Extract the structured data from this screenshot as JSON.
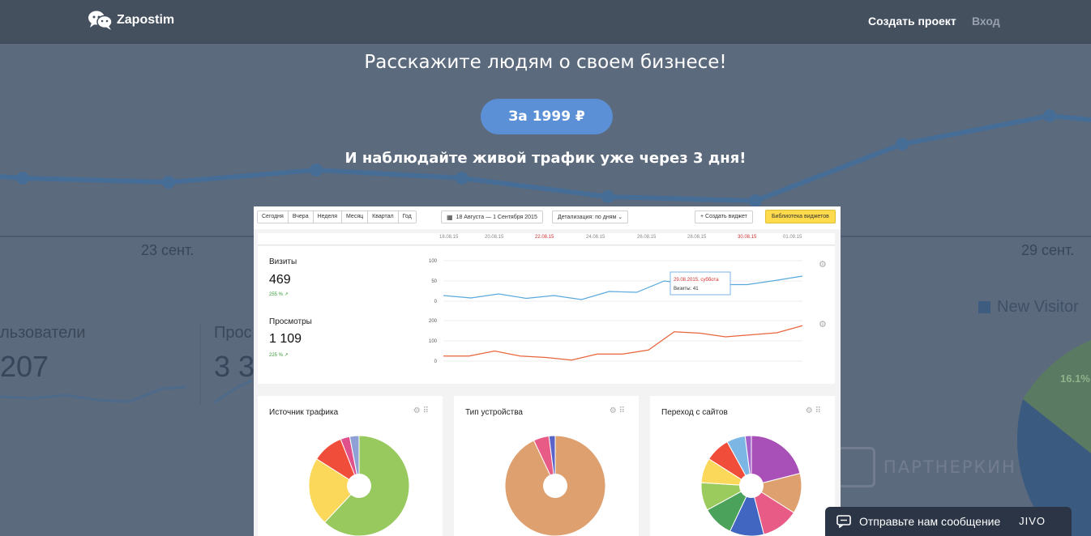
{
  "header": {
    "logo_text": "Zapostim",
    "nav_create": "Создать проект",
    "nav_login": "Вход"
  },
  "hero": {
    "title": "Расскажите людям о своем бизнесе!",
    "cta_label": "За 1999 ₽",
    "subtitle": "И наблюдайте живой трафик уже через 3 дня!"
  },
  "background": {
    "axis_left": "23 сент.",
    "axis_right": "29 сент.",
    "users_label": "льзователи",
    "users_value": "207",
    "views_label": "Прос",
    "views_value": "3 3",
    "legend_new_visitor": "New Visitor",
    "pie_pct": "16.1%",
    "watermark": "ПАРТНЕРКИН"
  },
  "dashboard": {
    "periods": [
      "Сегодня",
      "Вчера",
      "Неделя",
      "Месяц",
      "Квартал",
      "Год"
    ],
    "date_range": "18 Августа — 1 Сентября 2015",
    "detail": "Детализация: по дням",
    "create_widget": "Создать виджет",
    "library": "Библиотека виджетов",
    "timeline_labels": [
      {
        "text": "18.08.15",
        "holiday": false
      },
      {
        "text": "20.08.15",
        "holiday": false
      },
      {
        "text": "22.08.15",
        "holiday": true
      },
      {
        "text": "24.08.15",
        "holiday": false
      },
      {
        "text": "26.08.15",
        "holiday": false
      },
      {
        "text": "28.08.15",
        "holiday": false
      },
      {
        "text": "30.08.15",
        "holiday": true
      },
      {
        "text": "01.09.15",
        "holiday": false
      }
    ],
    "visits": {
      "title": "Визиты",
      "value": "469",
      "delta": "255 % ↗",
      "y_ticks": [
        "100",
        "50",
        "0"
      ],
      "series_color": "#5aa9dc",
      "series": [
        14,
        8,
        18,
        7,
        14,
        4,
        24,
        22,
        50,
        41,
        41,
        41,
        51,
        62
      ],
      "y_max": 100,
      "tooltip_date": "29.08.2015, суббота",
      "tooltip_value": "Визиты: 41"
    },
    "views": {
      "title": "Просмотры",
      "value": "1 109",
      "delta": "225 % ↗",
      "y_ticks": [
        "200",
        "100",
        "0"
      ],
      "series_color": "#e8643c",
      "series": [
        25,
        25,
        50,
        25,
        18,
        5,
        35,
        35,
        55,
        145,
        138,
        120,
        130,
        140,
        175
      ],
      "y_max": 200
    },
    "widgets": [
      {
        "title": "Источник трафика",
        "slices": [
          {
            "value": 62,
            "color": "#98c95e"
          },
          {
            "value": 22,
            "color": "#fbd75a"
          },
          {
            "value": 10,
            "color": "#f04e3a"
          },
          {
            "value": 3,
            "color": "#e0508b"
          },
          {
            "value": 3,
            "color": "#8fa0d6"
          }
        ]
      },
      {
        "title": "Тип устройства",
        "slices": [
          {
            "value": 93,
            "color": "#dfa070"
          },
          {
            "value": 5,
            "color": "#e85b86"
          },
          {
            "value": 2,
            "color": "#5a63c8"
          }
        ]
      },
      {
        "title": "Переход с сайтов",
        "slices": [
          {
            "value": 21,
            "color": "#a94fb8"
          },
          {
            "value": 13,
            "color": "#dfa070"
          },
          {
            "value": 12,
            "color": "#e85b86"
          },
          {
            "value": 11,
            "color": "#4166c2"
          },
          {
            "value": 10,
            "color": "#4aa25b"
          },
          {
            "value": 9,
            "color": "#9bcb5c"
          },
          {
            "value": 8,
            "color": "#fbd75a"
          },
          {
            "value": 8,
            "color": "#f04e3a"
          },
          {
            "value": 6,
            "color": "#7cb6e4"
          },
          {
            "value": 2,
            "color": "#a463c8"
          }
        ]
      }
    ]
  },
  "chat": {
    "label": "Отправьте нам сообщение",
    "brand": "JIVO"
  },
  "colors": {
    "page_bg": "#5c6a7e",
    "topbar": "#45505f",
    "cta": "#5b8fd6",
    "chat_bg": "#2b3546"
  }
}
